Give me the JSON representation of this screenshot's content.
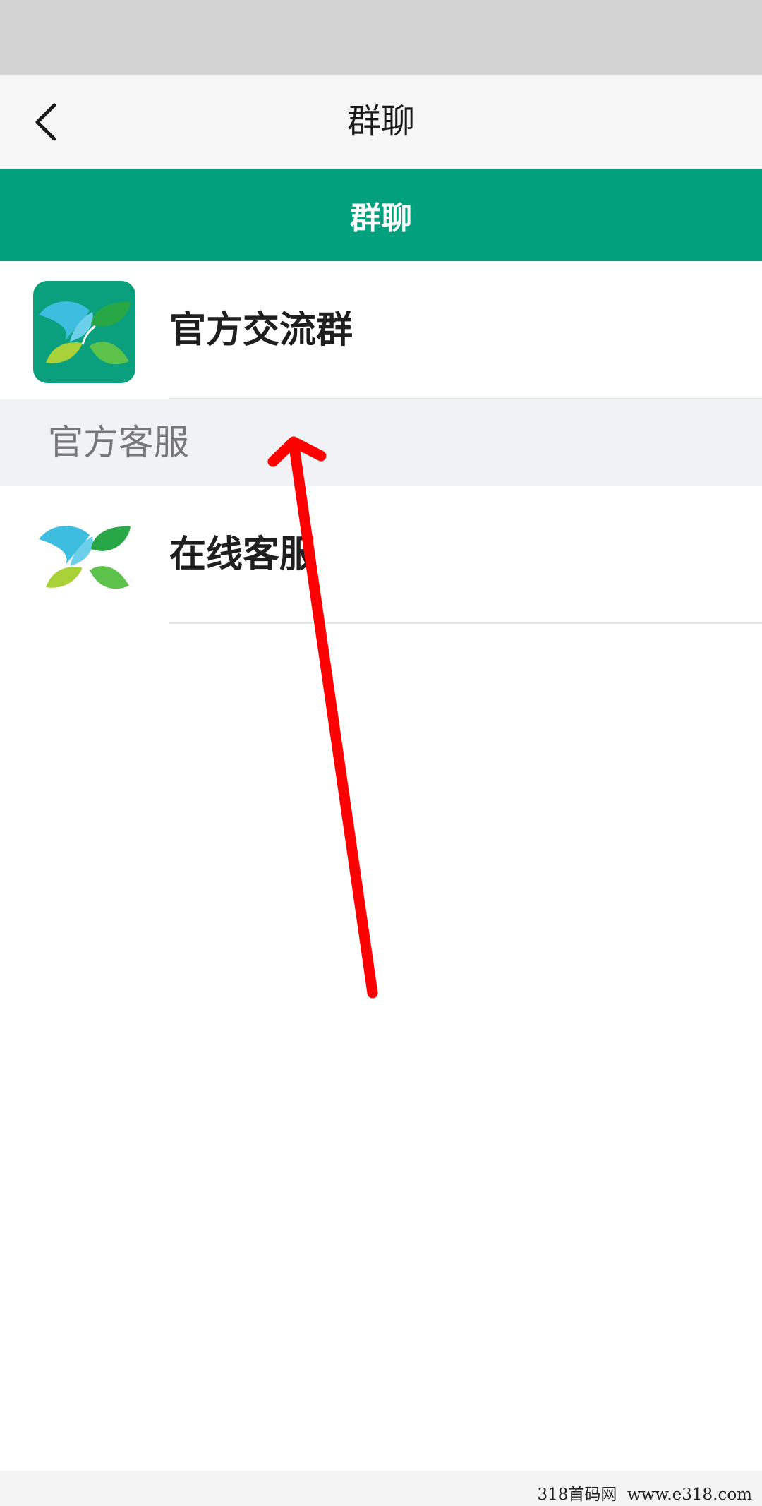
{
  "nav": {
    "title": "群聊",
    "back_icon": "chevron-left-icon"
  },
  "banner": {
    "label": "群聊",
    "color": "#02a07c"
  },
  "groups": [
    {
      "title": "官方交流群",
      "avatar_icon": "leaf-logo-icon"
    }
  ],
  "section": {
    "label": "官方客服"
  },
  "service": [
    {
      "title": "在线客服",
      "avatar_icon": "leaf-logo-icon"
    }
  ],
  "watermark": "318首码网  www.e318.com",
  "colors": {
    "brand_green": "#02a07c",
    "annotation_red": "#ff0000"
  }
}
